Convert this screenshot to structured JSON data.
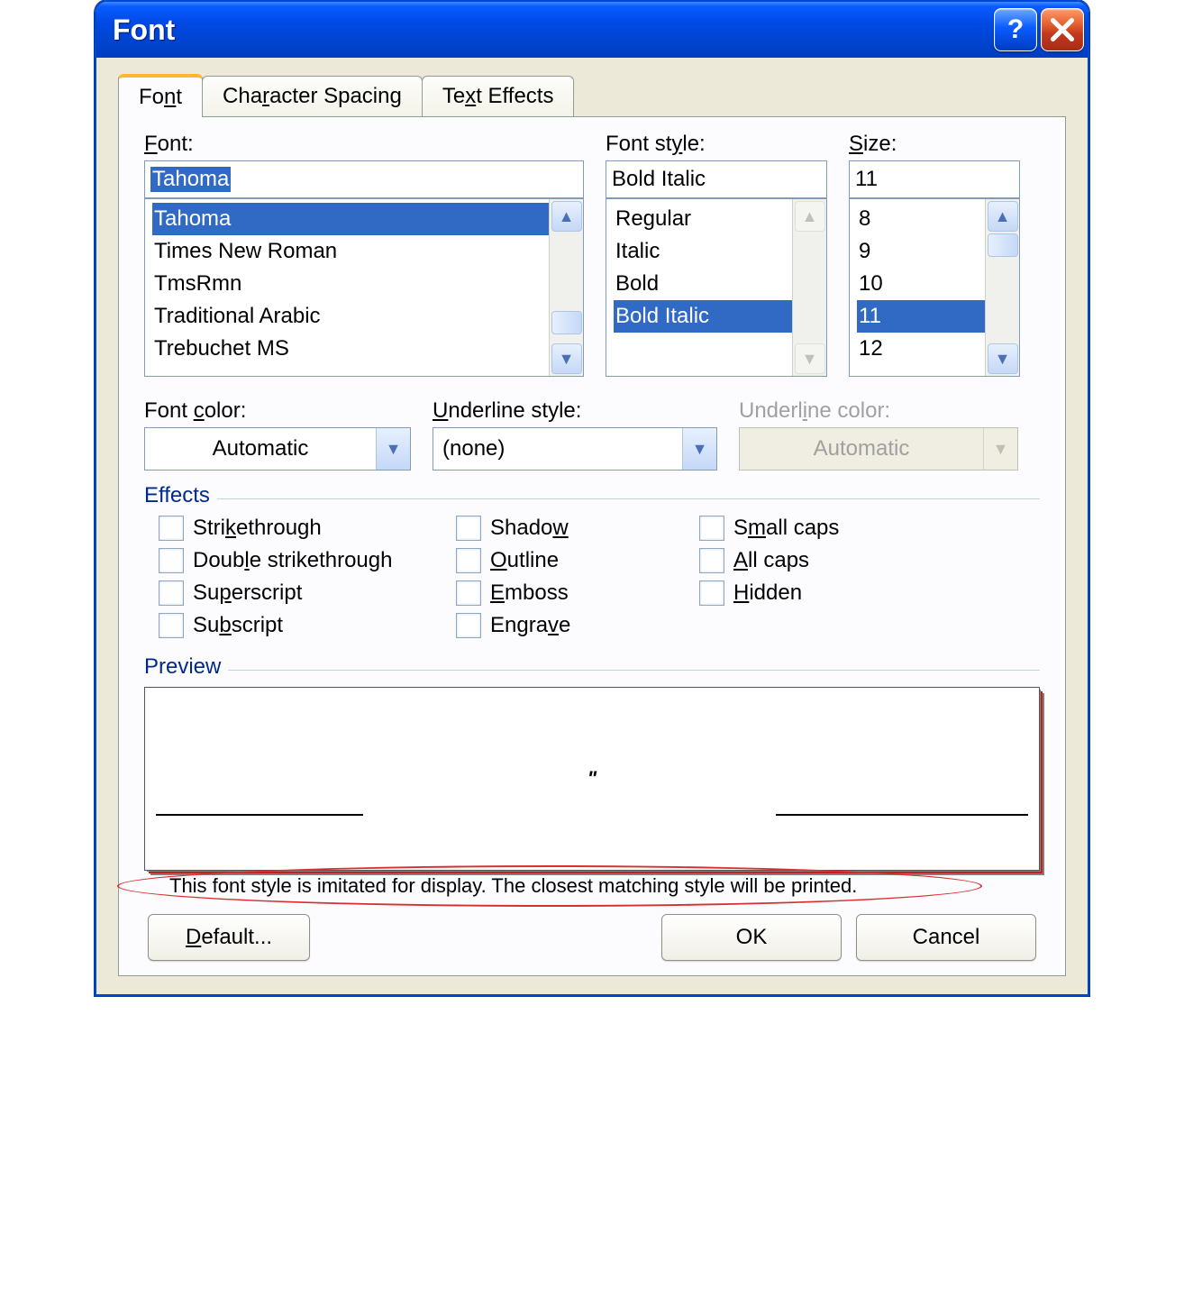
{
  "window": {
    "title": "Font"
  },
  "tabs": [
    "Font",
    "Character Spacing",
    "Text Effects"
  ],
  "font": {
    "label": "Font:",
    "value": "Tahoma",
    "options": [
      "Tahoma",
      "Times New Roman",
      "TmsRmn",
      "Traditional Arabic",
      "Trebuchet MS"
    ],
    "selected_index": 0
  },
  "style": {
    "label": "Font style:",
    "value": "Bold Italic",
    "options": [
      "Regular",
      "Italic",
      "Bold",
      "Bold Italic"
    ],
    "selected_index": 3
  },
  "size": {
    "label": "Size:",
    "value": "11",
    "options": [
      "8",
      "9",
      "10",
      "11",
      "12"
    ],
    "selected_index": 3
  },
  "font_color": {
    "label": "Font color:",
    "value": "Automatic"
  },
  "underline_style": {
    "label": "Underline style:",
    "value": "(none)"
  },
  "underline_color": {
    "label": "Underline color:",
    "value": "Automatic"
  },
  "effects_label": "Effects",
  "effects": {
    "strikethrough": "Strikethrough",
    "double_strikethrough": "Double strikethrough",
    "superscript": "Superscript",
    "subscript": "Subscript",
    "shadow": "Shadow",
    "outline": "Outline",
    "emboss": "Emboss",
    "engrave": "Engrave",
    "small_caps": "Small caps",
    "all_caps": "All caps",
    "hidden": "Hidden"
  },
  "preview_label": "Preview",
  "preview_sample": "\"",
  "preview_msg": "This font style is imitated for display. The closest matching style will be printed.",
  "buttons": {
    "default": "Default...",
    "ok": "OK",
    "cancel": "Cancel"
  }
}
